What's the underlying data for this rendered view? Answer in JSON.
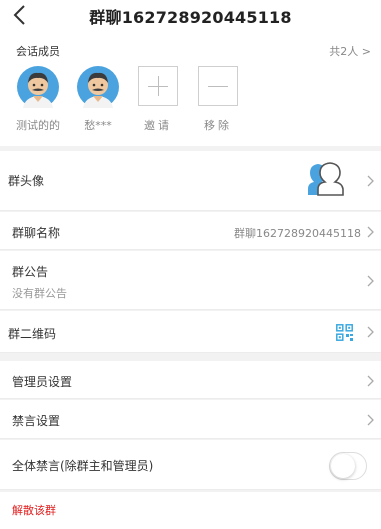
{
  "header": {
    "title": "群聊162728920445118"
  },
  "members_section": {
    "label": "会话成员",
    "count": "共2人 >",
    "members": [
      {
        "name": "测试的的"
      },
      {
        "name": "愁***"
      }
    ],
    "invite_label": "邀请",
    "remove_label": "移除"
  },
  "settings": {
    "group_avatar": {
      "label": "群头像"
    },
    "group_name": {
      "label": "群聊名称",
      "value": "群聊162728920445118"
    },
    "announcement": {
      "label": "群公告",
      "value": "没有群公告"
    },
    "qr_code": {
      "label": "群二维码"
    },
    "admin": {
      "label": "管理员设置"
    },
    "mute": {
      "label": "禁言设置"
    },
    "mute_all": {
      "label": "全体禁言(除群主和管理员)",
      "enabled": false
    }
  },
  "danger": {
    "label": "解散该群"
  },
  "colors": {
    "accent": "#3aa8e0",
    "danger": "#e02020",
    "avatar_bg": "#4aa3df"
  },
  "icons": [
    "back-arrow-icon",
    "chevron-right-icon",
    "group-avatar-icon",
    "qr-code-icon",
    "plus-icon",
    "minus-icon"
  ]
}
